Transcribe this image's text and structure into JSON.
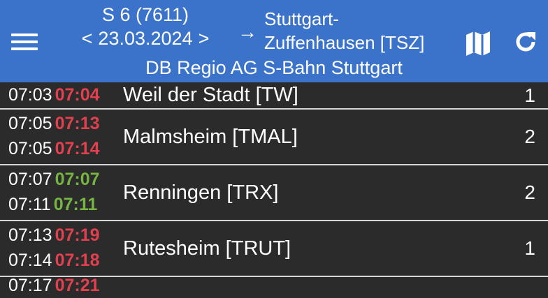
{
  "header": {
    "train": "S 6 (7611)",
    "prev_arrow": "<",
    "date": "23.03.2024",
    "next_arrow": ">",
    "direction_arrow": "→",
    "destination_line1": "Stuttgart-",
    "destination_line2": "Zuffenhausen [TSZ]",
    "operator": "DB Regio AG S-Bahn Stuttgart",
    "background_color": "#3a73c9"
  },
  "icons": {
    "menu": "hamburger-menu-icon",
    "map": "map-icon",
    "refresh": "refresh-icon"
  },
  "colors": {
    "late": "#e2404f",
    "on_time": "#76b541"
  },
  "stops": [
    {
      "arr_sched": "07:03",
      "arr_real": "07:04",
      "arr_status": "late",
      "station": "Weil der Stadt [TW]",
      "platform": "1"
    },
    {
      "arr_sched": "07:05",
      "arr_real": "07:13",
      "arr_status": "late",
      "dep_sched": "07:05",
      "dep_real": "07:14",
      "dep_status": "late",
      "station": "Malmsheim [TMAL]",
      "platform": "2"
    },
    {
      "arr_sched": "07:07",
      "arr_real": "07:07",
      "arr_status": "ontime",
      "dep_sched": "07:11",
      "dep_real": "07:11",
      "dep_status": "ontime",
      "station": "Renningen [TRX]",
      "platform": "2"
    },
    {
      "arr_sched": "07:13",
      "arr_real": "07:19",
      "arr_status": "late",
      "dep_sched": "07:14",
      "dep_real": "07:18",
      "dep_status": "late",
      "station": "Rutesheim [TRUT]",
      "platform": "1"
    },
    {
      "arr_sched": "07:17",
      "arr_real": "07:21",
      "arr_status": "late"
    }
  ]
}
